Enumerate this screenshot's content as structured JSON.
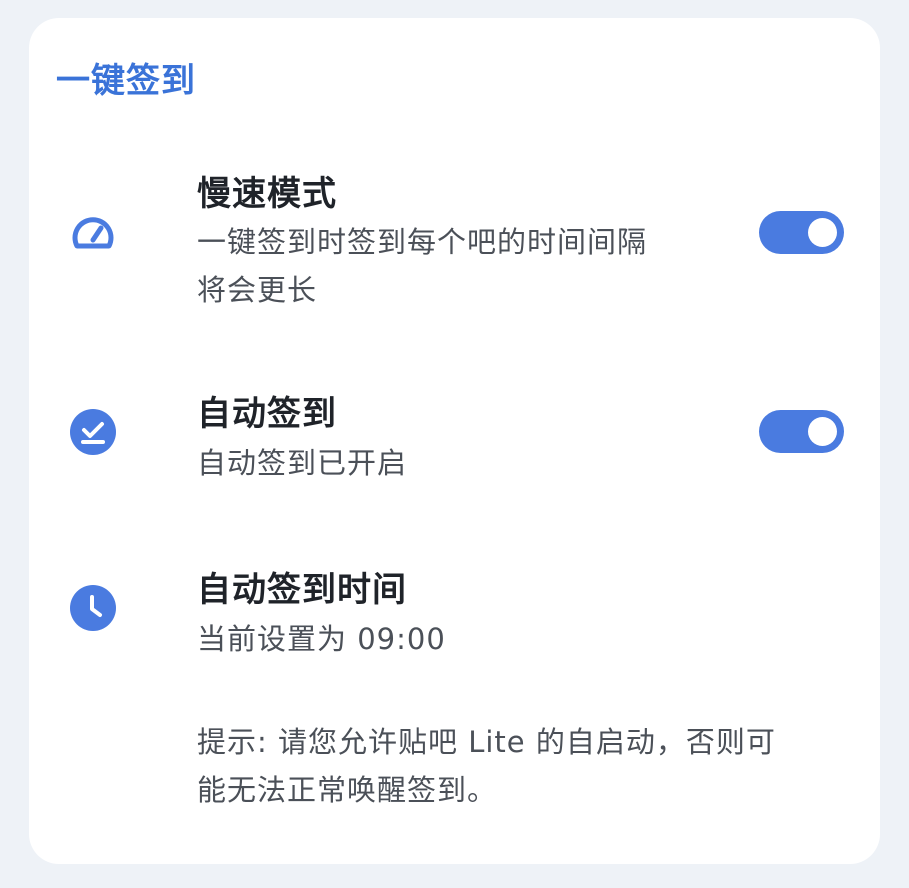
{
  "section": {
    "title": "一键签到"
  },
  "rows": {
    "slow_mode": {
      "title": "慢速模式",
      "subtitle_line1": "一键签到时签到每个吧的时间间隔",
      "subtitle_line2": "将会更长",
      "icon": "speedometer-icon",
      "toggle_on": true
    },
    "auto_sign": {
      "title": "自动签到",
      "subtitle": "自动签到已开启",
      "icon": "check-circle-icon",
      "toggle_on": true
    },
    "auto_sign_time": {
      "title": "自动签到时间",
      "subtitle": "当前设置为 09:00",
      "icon": "clock-icon"
    }
  },
  "hint": {
    "line1": "提示: 请您允许贴吧 Lite 的自启动，否则可",
    "line2": "能无法正常唤醒签到。"
  },
  "colors": {
    "accent": "#4a7be0",
    "title_accent": "#3a73d8",
    "background": "#eef2f7",
    "card": "#ffffff"
  }
}
